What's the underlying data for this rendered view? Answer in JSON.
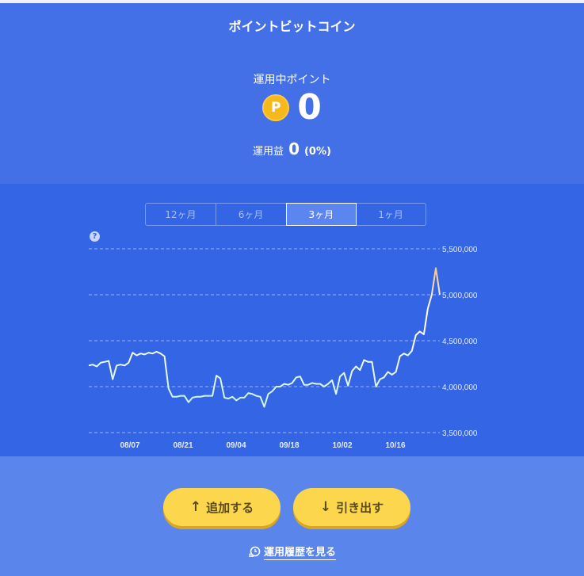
{
  "header": {
    "title": "ポイントビットコイン",
    "points_label": "運用中ポイント",
    "coin_letter": "P",
    "points_value": "0",
    "profit_label": "運用益",
    "profit_value": "0",
    "profit_percent": "(0%)"
  },
  "tabs": [
    {
      "label": "12ヶ月",
      "active": false
    },
    {
      "label": "6ヶ月",
      "active": false
    },
    {
      "label": "3ヶ月",
      "active": true
    },
    {
      "label": "1ヶ月",
      "active": false
    }
  ],
  "help_symbol": "?",
  "chart_data": {
    "type": "line",
    "x_tick_labels": [
      "08/07",
      "08/21",
      "09/04",
      "09/18",
      "10/02",
      "10/16"
    ],
    "y_tick_labels": [
      "5,500,000",
      "5,000,000",
      "4,500,000",
      "4,000,000",
      "3,500,000"
    ],
    "ylim": [
      3500000,
      5500000
    ],
    "grid": true,
    "line_colors": {
      "low": "#b8f0d6",
      "mid": "#ffffff",
      "high": "#f7a64a"
    },
    "values": [
      4230000,
      4240000,
      4220000,
      4260000,
      4270000,
      4280000,
      4080000,
      4230000,
      4240000,
      4230000,
      4260000,
      4370000,
      4340000,
      4360000,
      4350000,
      4370000,
      4360000,
      4380000,
      4360000,
      4330000,
      3980000,
      3890000,
      3890000,
      3900000,
      3900000,
      3830000,
      3880000,
      3890000,
      3890000,
      3900000,
      3900000,
      3900000,
      4120000,
      4090000,
      3880000,
      3870000,
      3890000,
      3850000,
      3880000,
      3880000,
      3930000,
      3920000,
      3900000,
      3890000,
      3780000,
      3920000,
      3950000,
      4000000,
      4000000,
      4030000,
      4020000,
      4040000,
      4100000,
      4110000,
      4020000,
      4020000,
      4040000,
      4030000,
      4030000,
      4000000,
      4030000,
      4070000,
      3920000,
      4110000,
      4150000,
      4010000,
      4170000,
      4220000,
      4180000,
      4290000,
      4270000,
      4270000,
      4000000,
      4080000,
      4100000,
      4160000,
      4130000,
      4160000,
      4330000,
      4360000,
      4340000,
      4390000,
      4560000,
      4600000,
      4570000,
      4850000,
      5000000,
      5290000,
      5000000
    ]
  },
  "buttons": {
    "add_label": "追加する",
    "withdraw_label": "引き出す",
    "add_arrow": "↑",
    "withdraw_arrow": "↓"
  },
  "history": {
    "icon": "history-icon",
    "label": "運用履歴を見る"
  }
}
